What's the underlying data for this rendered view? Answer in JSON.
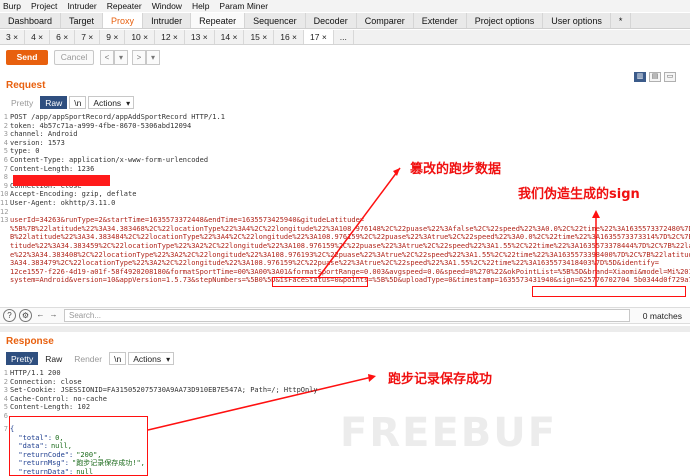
{
  "menubar": [
    "Burp",
    "Project",
    "Intruder",
    "Repeater",
    "Window",
    "Help",
    "Param Miner"
  ],
  "tabs": [
    {
      "label": "Dashboard",
      "state": ""
    },
    {
      "label": "Target",
      "state": ""
    },
    {
      "label": "Proxy",
      "state": "active"
    },
    {
      "label": "Intruder",
      "state": ""
    },
    {
      "label": "Repeater",
      "state": "sel"
    },
    {
      "label": "Sequencer",
      "state": ""
    },
    {
      "label": "Decoder",
      "state": ""
    },
    {
      "label": "Comparer",
      "state": ""
    },
    {
      "label": "Extender",
      "state": ""
    },
    {
      "label": "Project options",
      "state": ""
    },
    {
      "label": "User options",
      "state": ""
    },
    {
      "label": "*",
      "state": ""
    }
  ],
  "repeater_tabs": [
    "3 ×",
    "4 ×",
    "6 ×",
    "7 ×",
    "9 ×",
    "10 ×",
    "12 ×",
    "13 ×",
    "14 ×",
    "15 ×",
    "16 ×",
    "17 ×",
    "..."
  ],
  "repeater_active": "17 ×",
  "toolbar": {
    "send": "Send",
    "cancel": "Cancel",
    "prev": "<",
    "prev_dd": "▾",
    "next": ">",
    "next_dd": "▾"
  },
  "request": {
    "title": "Request",
    "tabs": {
      "pretty": "Pretty",
      "raw": "Raw",
      "newline": "\\n",
      "actions": "Actions"
    },
    "lines": [
      {
        "n": "1",
        "text": "POST /app/appSportRecord/appAddSportRecord HTTP/1.1"
      },
      {
        "n": "2",
        "text": "token: 4b57c71a-a999-4fbe-8670-5306abd12094"
      },
      {
        "n": "3",
        "text": "channel: Android"
      },
      {
        "n": "4",
        "text": "version: 1573"
      },
      {
        "n": "5",
        "text": "type: 0"
      },
      {
        "n": "6",
        "text": "Content-Type: application/x-www-form-urlencoded"
      },
      {
        "n": "7",
        "text": "Content-Length: 1236"
      },
      {
        "n": "8",
        "text": ""
      },
      {
        "n": "9",
        "text": "Connection: close"
      },
      {
        "n": "10",
        "text": "Accept-Encoding: gzip, deflate"
      },
      {
        "n": "11",
        "text": "User-Agent: okhttp/3.11.0"
      },
      {
        "n": "12",
        "text": ""
      },
      {
        "n": "13",
        "text": "userId=34263&runType=2&startTime=1635573372448&endTime=1635573425940&gitudeLatitude="
      },
      {
        "n": "",
        "text": "%5B%7B%22latitude%22%3A34.383468%2C%22locationType%22%3A4%2C%22longitude%22%3A108.976148%2C%22puase%22%3Afalse%2C%22speed%22%3A0.0%2C%22time%22%3A1635573372480%7D%2C%7"
      },
      {
        "n": "",
        "text": "B%22latitude%22%3A34.383484%2C%22locationType%22%3A4%2C%22longitude%22%3A108.976159%2C%22puase%22%3Atrue%2C%22speed%22%3A0.0%2C%22time%22%3A1635573373314%7D%2C%7B%22la"
      },
      {
        "n": "",
        "text": "titude%22%3A34.383459%2C%22locationType%22%3A2%2C%22longitude%22%3A108.976159%2C%22puase%22%3Atrue%2C%22speed%22%3A1.55%2C%22time%22%3A1635573378444%7D%2C%7B%22latitud"
      },
      {
        "n": "",
        "text": "e%22%3A34.383408%2C%22locationType%22%3A2%2C%22longitude%22%3A108.976193%2C%22puase%22%3Atrue%2C%22speed%22%3A1.55%2C%22time%22%3A1635573398400%7D%2C%7B%22latitude%22%"
      },
      {
        "n": "",
        "text": "3A34.383479%2C%22locationType%22%3A2%2C%22longitude%22%3A108.976159%2C%22puase%22%3Atrue%2C%22speed%22%3A1.55%2C%22time%22%3A1635573418403%7D%5D&identify="
      },
      {
        "n": "",
        "text": "12ce1557-f226-4d19-a01f-58f4920208180&formatSportTime=00%3A00%3A01&formatSportRange=0.003&avgspeed=0.0&speed=0%270%22&okPointList=%5B%5D&brand=Xiaomi&model=Mi%2010&"
      },
      {
        "n": "",
        "text": "system=Android&version=10&appVersion=1.5.73&stepNumbers=%5B0%5D&isFaceStatus=0&points=%5B%5D&uploadType=0&timestamp=1635573431940&sign=625776702704 5b0344d0f729a792fb6"
      }
    ]
  },
  "annotations": {
    "tampered": "篡改的跑步数据",
    "forged_sign": "我们伪造生成的sign",
    "saved": "跑步记录保存成功"
  },
  "search": {
    "placeholder": "Search...",
    "matches": "0 matches",
    "help": "?",
    "gear": "⚙",
    "prev": "←",
    "next": "→"
  },
  "response": {
    "title": "Response",
    "tabs": {
      "pretty": "Pretty",
      "raw": "Raw",
      "render": "Render",
      "newline": "\\n",
      "actions": "Actions"
    },
    "lines": [
      {
        "n": "1",
        "text": "HTTP/1.1 200"
      },
      {
        "n": "2",
        "text": "Connection: close"
      },
      {
        "n": "3",
        "text": "Set-Cookie: JSESSIONID=FA315052075730A9AA73D910EB7E547A; Path=/; HttpOnly"
      },
      {
        "n": "4",
        "text": "Cache-Control: no-cache"
      },
      {
        "n": "5",
        "text": "Content-Length: 102"
      },
      {
        "n": "6",
        "text": ""
      }
    ],
    "json_lines": [
      {
        "n": "7",
        "k": "{",
        "v": ""
      },
      {
        "n": "",
        "k": "  \"total\":",
        "v": "0,"
      },
      {
        "n": "",
        "k": "  \"data\":",
        "v": "null,"
      },
      {
        "n": "",
        "k": "  \"returnCode\":",
        "v": "\"200\","
      },
      {
        "n": "",
        "k": "  \"returnMsg\":",
        "v": "\"跑步记录保存成功!\","
      },
      {
        "n": "",
        "k": "  \"returnData\":",
        "v": "null"
      },
      {
        "n": "",
        "k": "}",
        "v": ""
      }
    ]
  },
  "watermark": "FREEBUF"
}
